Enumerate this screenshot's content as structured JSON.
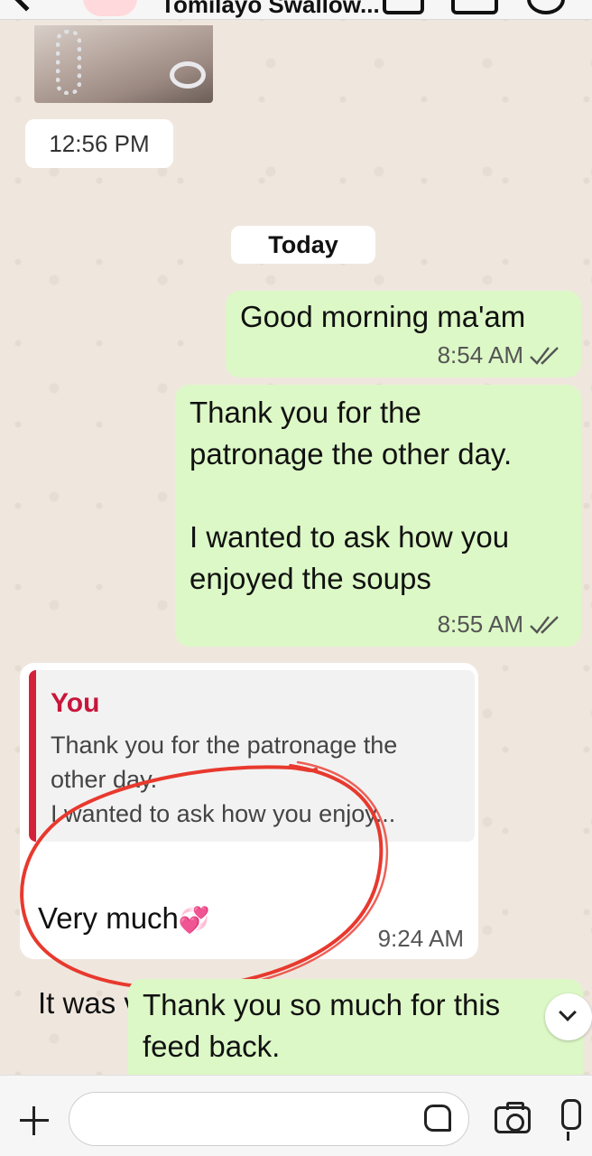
{
  "header": {
    "contact_name": "Tomilayo Swallow..."
  },
  "image_message": {
    "time": "12:56 PM"
  },
  "date_separator": "Today",
  "messages": [
    {
      "text": "Good morning ma'am",
      "time": "8:54 AM",
      "status": "read"
    },
    {
      "text": "Thank you for the\npatronage the other day.\n\nI wanted to ask how you\nenjoyed the soups",
      "time": "8:55 AM",
      "status": "read"
    },
    {
      "quote_author": "You",
      "quote_lines": [
        "Thank you for the patronage the",
        "other day.",
        "I wanted to ask how you enjoy..."
      ],
      "line1": "Very much",
      "line2": "It was very tasty",
      "time": "9:24 AM"
    },
    {
      "text": "Thank you so much for this\nfeed back."
    }
  ],
  "icons": {
    "back": "chevron-left-icon",
    "video": "video-call-icon",
    "phone": "phone-icon",
    "double_check": "double-check-icon",
    "hearts_emoji": "💞",
    "yum_emoji": "😋",
    "scroll_down": "chevron-down-icon",
    "plus": "plus-icon",
    "sticker": "sticker-icon",
    "camera": "camera-icon",
    "mic": "microphone-icon"
  },
  "colors": {
    "outgoing_bubble": "#dcf8c6",
    "incoming_bubble": "#ffffff",
    "read_ticks": "#555555",
    "quote_bar": "#d3213a",
    "annotation": "#e8392e"
  }
}
